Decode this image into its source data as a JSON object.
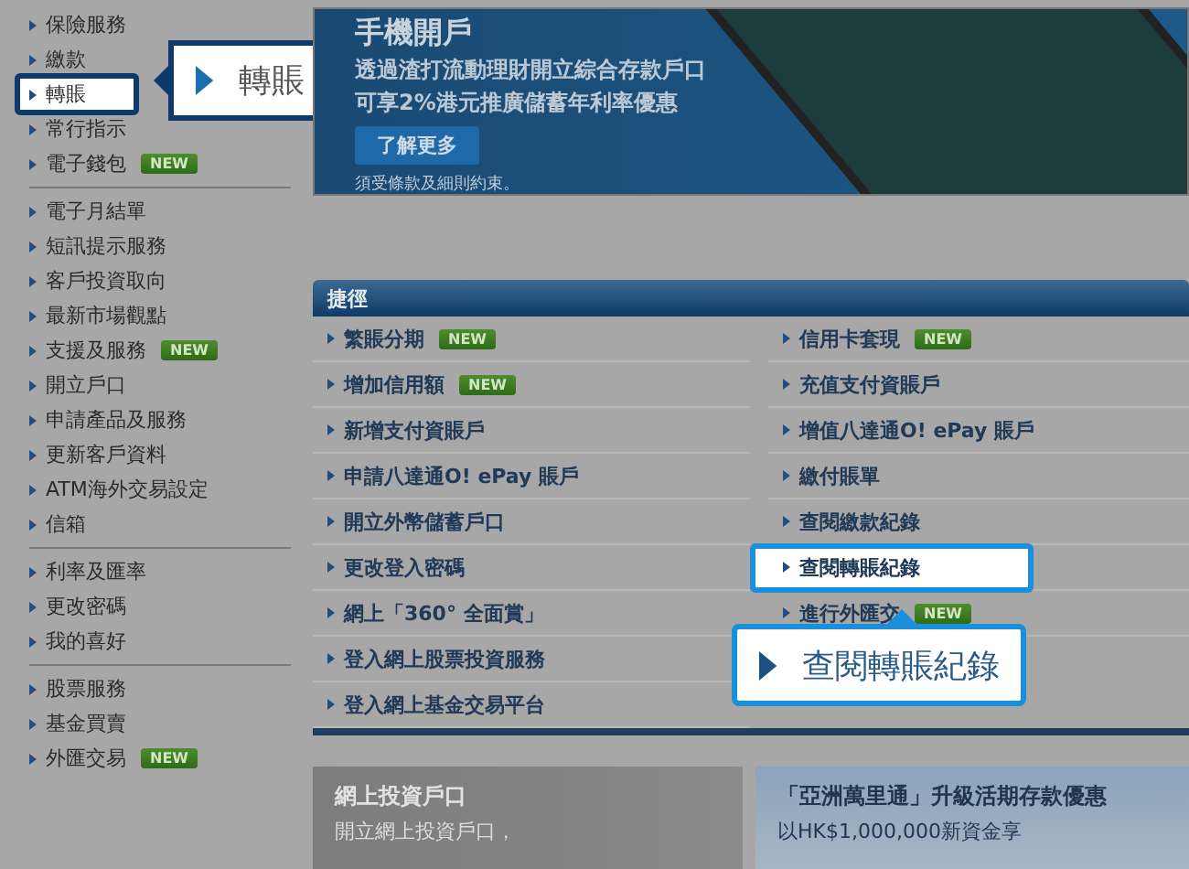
{
  "sidebar": {
    "groups": [
      {
        "items": [
          {
            "label": "保險服務",
            "selected": false
          },
          {
            "label": "繳款",
            "selected": false
          },
          {
            "label": "轉賬",
            "selected": true
          },
          {
            "label": "常行指示",
            "selected": false
          },
          {
            "label": "電子錢包",
            "badge": "NEW",
            "selected": false
          }
        ]
      },
      {
        "items": [
          {
            "label": "電子月結單",
            "selected": false
          },
          {
            "label": "短訊提示服務",
            "selected": false
          },
          {
            "label": "客戶投資取向",
            "selected": false
          },
          {
            "label": "最新市場觀點",
            "selected": false
          },
          {
            "label": "支援及服務",
            "badge": "NEW",
            "selected": false
          },
          {
            "label": "開立戶口",
            "selected": false
          },
          {
            "label": "申請產品及服務",
            "selected": false
          },
          {
            "label": "更新客戶資料",
            "selected": false
          },
          {
            "label": "ATM海外交易設定",
            "selected": false
          },
          {
            "label": "信箱",
            "selected": false
          }
        ]
      },
      {
        "items": [
          {
            "label": "利率及匯率",
            "selected": false
          },
          {
            "label": "更改密碼",
            "selected": false
          },
          {
            "label": "我的喜好",
            "selected": false
          }
        ]
      },
      {
        "items": [
          {
            "label": "股票服務",
            "selected": false
          },
          {
            "label": "基金買賣",
            "selected": false
          },
          {
            "label": "外匯交易",
            "badge": "NEW",
            "selected": false
          }
        ]
      }
    ]
  },
  "sidebar_callout": "轉賬",
  "banner": {
    "title": "手機開戶",
    "lines": [
      "透過渣打流動理財開立綜合存款戶口",
      "可享2%港元推廣儲蓄年利率優惠"
    ],
    "button": "了解更多",
    "note": "須受條款及細則約束。"
  },
  "shortcuts": {
    "title": "捷徑",
    "columns": [
      [
        {
          "label": "繁賬分期",
          "badge": "NEW",
          "selected": false
        },
        {
          "label": "增加信用額",
          "badge": "NEW",
          "selected": false
        },
        {
          "label": "新增支付資賬戶",
          "selected": false
        },
        {
          "label": "申請八達通O! ePay 賬戶",
          "selected": false
        },
        {
          "label": "開立外幣儲蓄戶口",
          "selected": false
        },
        {
          "label": "更改登入密碼",
          "selected": false
        },
        {
          "label": "網上「360° 全面賞」",
          "selected": false
        },
        {
          "label": "登入網上股票投資服務",
          "selected": false
        },
        {
          "label": "登入網上基金交易平台",
          "selected": false
        }
      ],
      [
        {
          "label": "信用卡套現",
          "badge": "NEW",
          "selected": false
        },
        {
          "label": "充值支付資賬戶",
          "selected": false
        },
        {
          "label": "增值八達通O! ePay 賬戶",
          "selected": false
        },
        {
          "label": "繳付賬單",
          "selected": false
        },
        {
          "label": "查閱繳款紀錄",
          "selected": false
        },
        {
          "label": "查閱轉賬紀錄",
          "selected": true
        },
        {
          "label": "進行外匯交",
          "badge": "NEW",
          "selected": false
        }
      ]
    ]
  },
  "shortcut_callout": "查閱轉賬紀錄",
  "promos": [
    {
      "title": "網上投資戶口",
      "text": "開立網上投資戶口，"
    },
    {
      "title": "「亞洲萬里通」升級活期存款優惠",
      "text": "以HK$1,000,000新資金享"
    }
  ]
}
